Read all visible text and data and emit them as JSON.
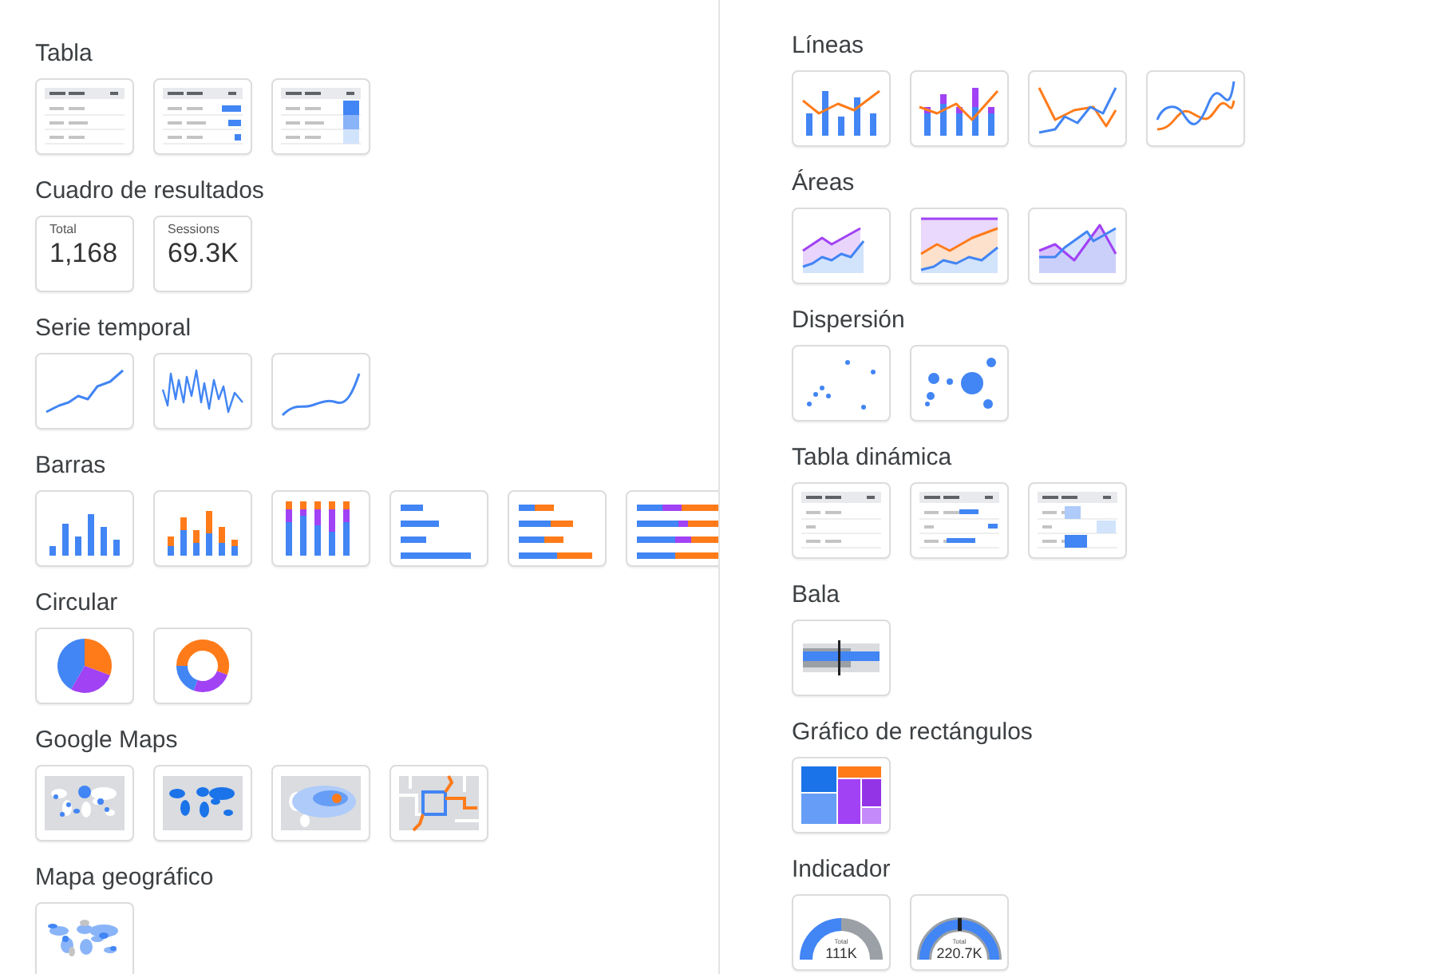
{
  "columns": [
    {
      "sections": [
        {
          "title": "Tabla",
          "tiles": [
            {
              "kind": "table"
            },
            {
              "kind": "table-bars"
            },
            {
              "kind": "table-heatmap"
            }
          ]
        },
        {
          "title": "Cuadro de resultados",
          "tiles": [
            {
              "kind": "scorecard",
              "label": "Total",
              "value": "1,168"
            },
            {
              "kind": "scorecard",
              "label": "Sessions",
              "value": "69.3K"
            }
          ]
        },
        {
          "title": "Serie temporal",
          "tiles": [
            {
              "kind": "timeseries"
            },
            {
              "kind": "sparkline"
            },
            {
              "kind": "smooth-series"
            }
          ]
        },
        {
          "title": "Barras",
          "tiles": [
            {
              "kind": "column"
            },
            {
              "kind": "stacked-column"
            },
            {
              "kind": "stacked-column-full"
            },
            {
              "kind": "bar"
            },
            {
              "kind": "stacked-bar"
            },
            {
              "kind": "stacked-bar-full"
            }
          ]
        },
        {
          "title": "Circular",
          "tiles": [
            {
              "kind": "pie"
            },
            {
              "kind": "donut"
            }
          ]
        },
        {
          "title": "Google Maps",
          "tiles": [
            {
              "kind": "bubble-map"
            },
            {
              "kind": "filled-map"
            },
            {
              "kind": "heat-map"
            },
            {
              "kind": "line-map"
            }
          ]
        },
        {
          "title": "Mapa geográfico",
          "tiles": [
            {
              "kind": "geo-map"
            }
          ]
        }
      ]
    },
    {
      "sections": [
        {
          "title": "Líneas",
          "tiles": [
            {
              "kind": "combo"
            },
            {
              "kind": "stacked-combo"
            },
            {
              "kind": "line"
            },
            {
              "kind": "smooth-line"
            }
          ]
        },
        {
          "title": "Áreas",
          "tiles": [
            {
              "kind": "area"
            },
            {
              "kind": "area-full"
            },
            {
              "kind": "area-overlap"
            }
          ]
        },
        {
          "title": "Dispersión",
          "tiles": [
            {
              "kind": "scatter"
            },
            {
              "kind": "bubble"
            }
          ]
        },
        {
          "title": "Tabla dinámica",
          "tiles": [
            {
              "kind": "pivot"
            },
            {
              "kind": "pivot-bars"
            },
            {
              "kind": "pivot-heatmap"
            }
          ]
        },
        {
          "title": "Bala",
          "tiles": [
            {
              "kind": "bullet"
            }
          ]
        },
        {
          "title": "Gráfico de rectángulos",
          "tiles": [
            {
              "kind": "treemap"
            }
          ]
        },
        {
          "title": "Indicador",
          "tiles": [
            {
              "kind": "gauge",
              "label": "Total",
              "value": "111K"
            },
            {
              "kind": "gauge-target",
              "label": "Total",
              "value": "220.7K"
            }
          ]
        }
      ]
    }
  ]
}
